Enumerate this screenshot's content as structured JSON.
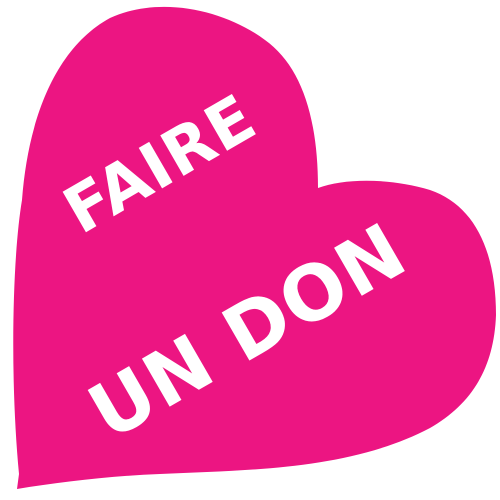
{
  "badge": {
    "line1": "FAIRE",
    "line2": "UN DON",
    "heart_color": "#EC1582",
    "text_color": "#FFFFFF"
  }
}
